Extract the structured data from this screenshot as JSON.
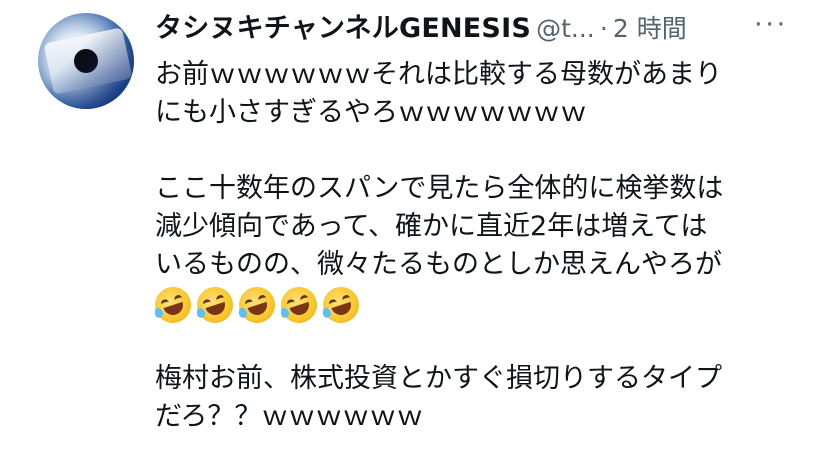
{
  "header": {
    "display_name": "タシヌキチャンネルGENESIS",
    "handle": "@t...",
    "separator": "·",
    "timestamp": "2 時間",
    "more_menu": "···"
  },
  "post": {
    "lines": [
      "お前ｗｗｗｗｗｗそれは比較する母数があまり",
      "にも小さすぎるやろｗｗｗｗｗｗｗ",
      "",
      "ここ十数年のスパンで見たら全体的に検挙数は",
      "減少傾向であって、確かに直近2年は増えては",
      "いるものの、微々たるものとしか思えんやろが",
      "",
      "",
      "梅村お前、株式投資とかすぐ損切りするタイプ",
      "だろ？？ｗｗｗｗｗｗ"
    ],
    "emoji_name": "rolling-on-the-floor-laughing-icon",
    "emoji_count": 5
  },
  "colors": {
    "text": "#0f1419",
    "secondary": "#536471",
    "background": "#ffffff"
  }
}
